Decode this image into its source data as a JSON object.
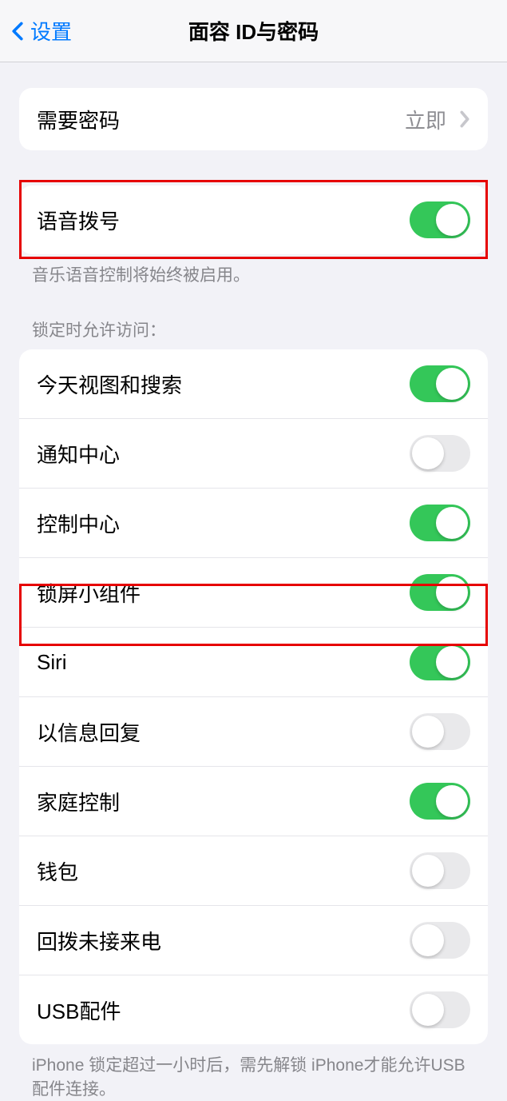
{
  "nav": {
    "back_label": "设置",
    "title": "面容 ID与密码"
  },
  "passcode_group": {
    "require_passcode_label": "需要密码",
    "require_passcode_value": "立即"
  },
  "voice_dial": {
    "label": "语音拨号",
    "on": true,
    "footer": "音乐语音控制将始终被启用。"
  },
  "lock_access": {
    "header": "锁定时允许访问：",
    "items": [
      {
        "label": "今天视图和搜索",
        "on": true
      },
      {
        "label": "通知中心",
        "on": false
      },
      {
        "label": "控制中心",
        "on": true
      },
      {
        "label": "锁屏小组件",
        "on": true
      },
      {
        "label": "Siri",
        "on": true
      },
      {
        "label": "以信息回复",
        "on": false
      },
      {
        "label": "家庭控制",
        "on": true
      },
      {
        "label": "钱包",
        "on": false
      },
      {
        "label": "回拨未接来电",
        "on": false
      },
      {
        "label": "USB配件",
        "on": false
      }
    ],
    "footer": "iPhone 锁定超过一小时后，需先解锁 iPhone才能允许USB 配件连接。"
  }
}
